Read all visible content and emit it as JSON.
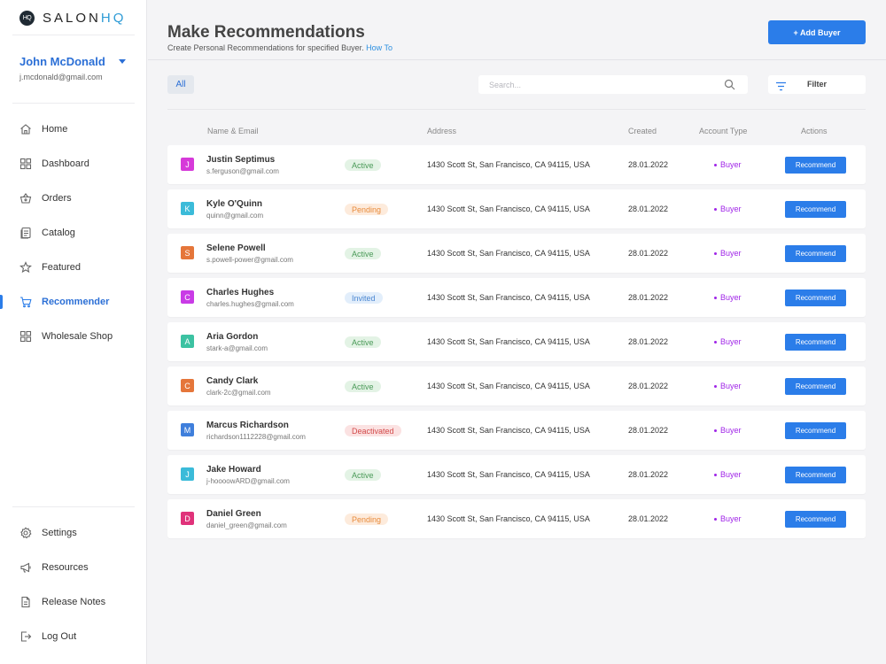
{
  "brand": {
    "mark": "HQ",
    "name_part1": "SALON",
    "name_part2": "HQ"
  },
  "user": {
    "name": "John McDonald",
    "email": "j.mcdonald@gmail.com"
  },
  "nav": [
    {
      "label": "Home",
      "icon": "home-icon"
    },
    {
      "label": "Dashboard",
      "icon": "dashboard-icon"
    },
    {
      "label": "Orders",
      "icon": "basket-icon"
    },
    {
      "label": "Catalog",
      "icon": "catalog-icon"
    },
    {
      "label": "Featured",
      "icon": "star-icon"
    },
    {
      "label": "Recommender",
      "icon": "cart-icon",
      "active": true
    },
    {
      "label": "Wholesale Shop",
      "icon": "grid-icon"
    }
  ],
  "bottom_nav": [
    {
      "label": "Settings",
      "icon": "gear-icon"
    },
    {
      "label": "Resources",
      "icon": "megaphone-icon"
    },
    {
      "label": "Release Notes",
      "icon": "document-icon"
    },
    {
      "label": "Log Out",
      "icon": "logout-icon"
    }
  ],
  "header": {
    "title": "Make Recommendations",
    "subtitle": "Create Personal Recommendations for specified Buyer.",
    "subtitle_link": "How To",
    "add_button": "+ Add Buyer"
  },
  "toolbar": {
    "all_label": "All",
    "search_placeholder": "Search...",
    "filter_label": "Filter"
  },
  "table": {
    "columns": {
      "name": "Name & Email",
      "address": "Address",
      "created": "Created",
      "account_type": "Account Type",
      "actions": "Actions"
    },
    "rows": [
      {
        "initial": "J",
        "color": "#d63ad9",
        "name": "Justin Septimus",
        "email": "s.ferguson@gmail.com",
        "status": "Active",
        "status_kind": "active",
        "address": "1430 Scott St, San Francisco, CA 94115, USA",
        "created": "28.01.2022",
        "type": "Buyer",
        "action": "Recommend"
      },
      {
        "initial": "K",
        "color": "#3bbbd9",
        "name": "Kyle O'Quinn",
        "email": "quinn@gmail.com",
        "status": "Pending",
        "status_kind": "pending",
        "address": "1430 Scott St, San Francisco, CA 94115, USA",
        "created": "28.01.2022",
        "type": "Buyer",
        "action": "Recommend"
      },
      {
        "initial": "S",
        "color": "#e5763a",
        "name": "Selene Powell",
        "email": "s.powell-power@gmail.com",
        "status": "Active",
        "status_kind": "active",
        "address": "1430 Scott St, San Francisco, CA 94115, USA",
        "created": "28.01.2022",
        "type": "Buyer",
        "action": "Recommend"
      },
      {
        "initial": "C",
        "color": "#c93be6",
        "name": "Charles Hughes",
        "email": "charles.hughes@gmail.com",
        "status": "Invited",
        "status_kind": "invited",
        "address": "1430 Scott St, San Francisco, CA 94115, USA",
        "created": "28.01.2022",
        "type": "Buyer",
        "action": "Recommend"
      },
      {
        "initial": "A",
        "color": "#3cc2a2",
        "name": "Aria Gordon",
        "email": "stark-a@gmail.com",
        "status": "Active",
        "status_kind": "active",
        "address": "1430 Scott St, San Francisco, CA 94115, USA",
        "created": "28.01.2022",
        "type": "Buyer",
        "action": "Recommend"
      },
      {
        "initial": "C",
        "color": "#e5763a",
        "name": "Candy Clark",
        "email": "clark-2c@gmail.com",
        "status": "Active",
        "status_kind": "active",
        "address": "1430 Scott St, San Francisco, CA 94115, USA",
        "created": "28.01.2022",
        "type": "Buyer",
        "action": "Recommend"
      },
      {
        "initial": "M",
        "color": "#3f7fdc",
        "name": "Marcus Richardson",
        "email": "richardson1112228@gmail.com",
        "status": "Deactivated",
        "status_kind": "deactivated",
        "address": "1430 Scott St, San Francisco, CA 94115, USA",
        "created": "28.01.2022",
        "type": "Buyer",
        "action": "Recommend"
      },
      {
        "initial": "J",
        "color": "#3bbbd9",
        "name": "Jake Howard",
        "email": "j-hoooowARD@gmail.com",
        "status": "Active",
        "status_kind": "active",
        "address": "1430 Scott St, San Francisco, CA 94115, USA",
        "created": "28.01.2022",
        "type": "Buyer",
        "action": "Recommend"
      },
      {
        "initial": "D",
        "color": "#e0327a",
        "name": "Daniel Green",
        "email": "daniel_green@gmail.com",
        "status": "Pending",
        "status_kind": "pending",
        "address": "1430 Scott St, San Francisco, CA 94115, USA",
        "created": "28.01.2022",
        "type": "Buyer",
        "action": "Recommend"
      }
    ]
  },
  "colors": {
    "primary": "#2b7de9",
    "buyer": "#a025e8"
  }
}
